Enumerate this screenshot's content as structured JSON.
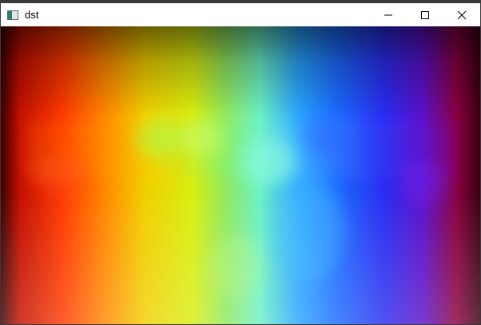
{
  "window": {
    "title": "dst",
    "app_icon": "app-icon",
    "controls": {
      "minimize_icon": "minimize-icon",
      "maximize_icon": "maximize-icon",
      "close_icon": "close-icon"
    }
  },
  "image": {
    "description_icon": "rainbow-spectrum-image"
  }
}
